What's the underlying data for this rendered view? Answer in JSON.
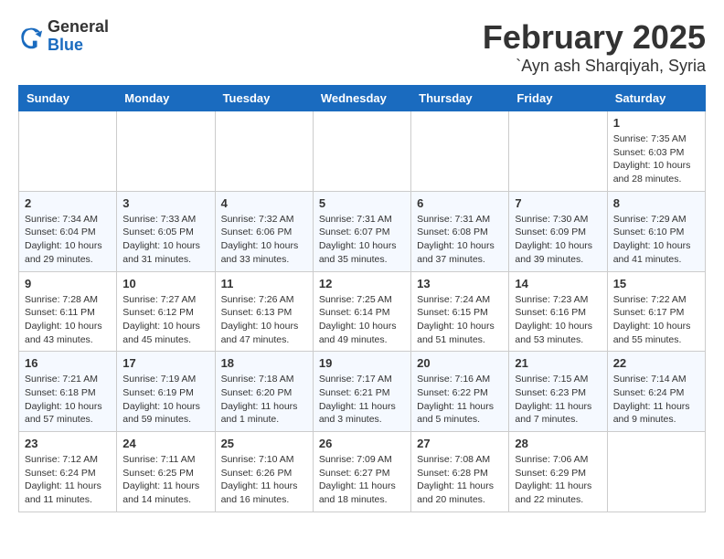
{
  "header": {
    "logo_general": "General",
    "logo_blue": "Blue",
    "month": "February 2025",
    "location": "`Ayn ash Sharqiyah, Syria"
  },
  "days_of_week": [
    "Sunday",
    "Monday",
    "Tuesday",
    "Wednesday",
    "Thursday",
    "Friday",
    "Saturday"
  ],
  "weeks": [
    [
      {
        "day": "",
        "info": ""
      },
      {
        "day": "",
        "info": ""
      },
      {
        "day": "",
        "info": ""
      },
      {
        "day": "",
        "info": ""
      },
      {
        "day": "",
        "info": ""
      },
      {
        "day": "",
        "info": ""
      },
      {
        "day": "1",
        "info": "Sunrise: 7:35 AM\nSunset: 6:03 PM\nDaylight: 10 hours and 28 minutes."
      }
    ],
    [
      {
        "day": "2",
        "info": "Sunrise: 7:34 AM\nSunset: 6:04 PM\nDaylight: 10 hours and 29 minutes."
      },
      {
        "day": "3",
        "info": "Sunrise: 7:33 AM\nSunset: 6:05 PM\nDaylight: 10 hours and 31 minutes."
      },
      {
        "day": "4",
        "info": "Sunrise: 7:32 AM\nSunset: 6:06 PM\nDaylight: 10 hours and 33 minutes."
      },
      {
        "day": "5",
        "info": "Sunrise: 7:31 AM\nSunset: 6:07 PM\nDaylight: 10 hours and 35 minutes."
      },
      {
        "day": "6",
        "info": "Sunrise: 7:31 AM\nSunset: 6:08 PM\nDaylight: 10 hours and 37 minutes."
      },
      {
        "day": "7",
        "info": "Sunrise: 7:30 AM\nSunset: 6:09 PM\nDaylight: 10 hours and 39 minutes."
      },
      {
        "day": "8",
        "info": "Sunrise: 7:29 AM\nSunset: 6:10 PM\nDaylight: 10 hours and 41 minutes."
      }
    ],
    [
      {
        "day": "9",
        "info": "Sunrise: 7:28 AM\nSunset: 6:11 PM\nDaylight: 10 hours and 43 minutes."
      },
      {
        "day": "10",
        "info": "Sunrise: 7:27 AM\nSunset: 6:12 PM\nDaylight: 10 hours and 45 minutes."
      },
      {
        "day": "11",
        "info": "Sunrise: 7:26 AM\nSunset: 6:13 PM\nDaylight: 10 hours and 47 minutes."
      },
      {
        "day": "12",
        "info": "Sunrise: 7:25 AM\nSunset: 6:14 PM\nDaylight: 10 hours and 49 minutes."
      },
      {
        "day": "13",
        "info": "Sunrise: 7:24 AM\nSunset: 6:15 PM\nDaylight: 10 hours and 51 minutes."
      },
      {
        "day": "14",
        "info": "Sunrise: 7:23 AM\nSunset: 6:16 PM\nDaylight: 10 hours and 53 minutes."
      },
      {
        "day": "15",
        "info": "Sunrise: 7:22 AM\nSunset: 6:17 PM\nDaylight: 10 hours and 55 minutes."
      }
    ],
    [
      {
        "day": "16",
        "info": "Sunrise: 7:21 AM\nSunset: 6:18 PM\nDaylight: 10 hours and 57 minutes."
      },
      {
        "day": "17",
        "info": "Sunrise: 7:19 AM\nSunset: 6:19 PM\nDaylight: 10 hours and 59 minutes."
      },
      {
        "day": "18",
        "info": "Sunrise: 7:18 AM\nSunset: 6:20 PM\nDaylight: 11 hours and 1 minute."
      },
      {
        "day": "19",
        "info": "Sunrise: 7:17 AM\nSunset: 6:21 PM\nDaylight: 11 hours and 3 minutes."
      },
      {
        "day": "20",
        "info": "Sunrise: 7:16 AM\nSunset: 6:22 PM\nDaylight: 11 hours and 5 minutes."
      },
      {
        "day": "21",
        "info": "Sunrise: 7:15 AM\nSunset: 6:23 PM\nDaylight: 11 hours and 7 minutes."
      },
      {
        "day": "22",
        "info": "Sunrise: 7:14 AM\nSunset: 6:24 PM\nDaylight: 11 hours and 9 minutes."
      }
    ],
    [
      {
        "day": "23",
        "info": "Sunrise: 7:12 AM\nSunset: 6:24 PM\nDaylight: 11 hours and 11 minutes."
      },
      {
        "day": "24",
        "info": "Sunrise: 7:11 AM\nSunset: 6:25 PM\nDaylight: 11 hours and 14 minutes."
      },
      {
        "day": "25",
        "info": "Sunrise: 7:10 AM\nSunset: 6:26 PM\nDaylight: 11 hours and 16 minutes."
      },
      {
        "day": "26",
        "info": "Sunrise: 7:09 AM\nSunset: 6:27 PM\nDaylight: 11 hours and 18 minutes."
      },
      {
        "day": "27",
        "info": "Sunrise: 7:08 AM\nSunset: 6:28 PM\nDaylight: 11 hours and 20 minutes."
      },
      {
        "day": "28",
        "info": "Sunrise: 7:06 AM\nSunset: 6:29 PM\nDaylight: 11 hours and 22 minutes."
      },
      {
        "day": "",
        "info": ""
      }
    ]
  ]
}
